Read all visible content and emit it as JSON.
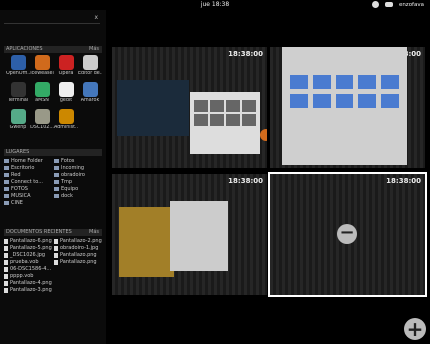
{
  "topbar": {
    "clock": "jue 18:38",
    "user": "enzofava"
  },
  "search": {
    "placeholder": "",
    "clear_icon": "x"
  },
  "sidebar": {
    "apps_header": "APLICACIONES",
    "apps_more": "Más",
    "apps": [
      {
        "label": "OpenOffi...",
        "color": "#2d5fa8"
      },
      {
        "label": "Iceweasel",
        "color": "#d06a1c"
      },
      {
        "label": "Opera",
        "color": "#c22"
      },
      {
        "label": "Editor de...",
        "color": "#ccc"
      },
      {
        "label": "Terminal",
        "color": "#333"
      },
      {
        "label": "aMSN",
        "color": "#3a6"
      },
      {
        "label": "gedit",
        "color": "#eee"
      },
      {
        "label": "Amarok",
        "color": "#4477bb"
      },
      {
        "label": "Gwenp",
        "color": "#5a8"
      },
      {
        "label": "DSC102...",
        "color": "#998"
      },
      {
        "label": "Administ...",
        "color": "#c80"
      }
    ],
    "places_header": "LUGARES",
    "places": [
      "Home Folder",
      "Fotos",
      "Escritorio",
      "Incoming",
      "Red",
      "obradoiro",
      "Connect to...",
      "Tmp",
      "FOTOS",
      "Equipo",
      "MUSICA",
      "dock",
      "CINE",
      ""
    ],
    "recent_header": "DOCUMENTOS RECIENTES",
    "recent_more": "Más",
    "recent": [
      "Pantallazo-6.png",
      "Pantallazo-2.png",
      "Pantallazo-5.png",
      "obradoiro-1.jpg",
      "_DSC1026.jpg",
      "Pantallazo.png",
      "prueba.vob",
      "Pantallazo.png",
      "06-DSC1586-4...",
      "",
      "pppp.vob",
      "",
      "Pantallazo-4.png",
      "",
      "Pantallazo-3.png",
      ""
    ]
  },
  "workspaces": [
    {
      "clock": "18:38:00"
    },
    {
      "clock": "18:38:00"
    },
    {
      "clock": "18:38:00"
    },
    {
      "clock": "18:38:00"
    }
  ]
}
